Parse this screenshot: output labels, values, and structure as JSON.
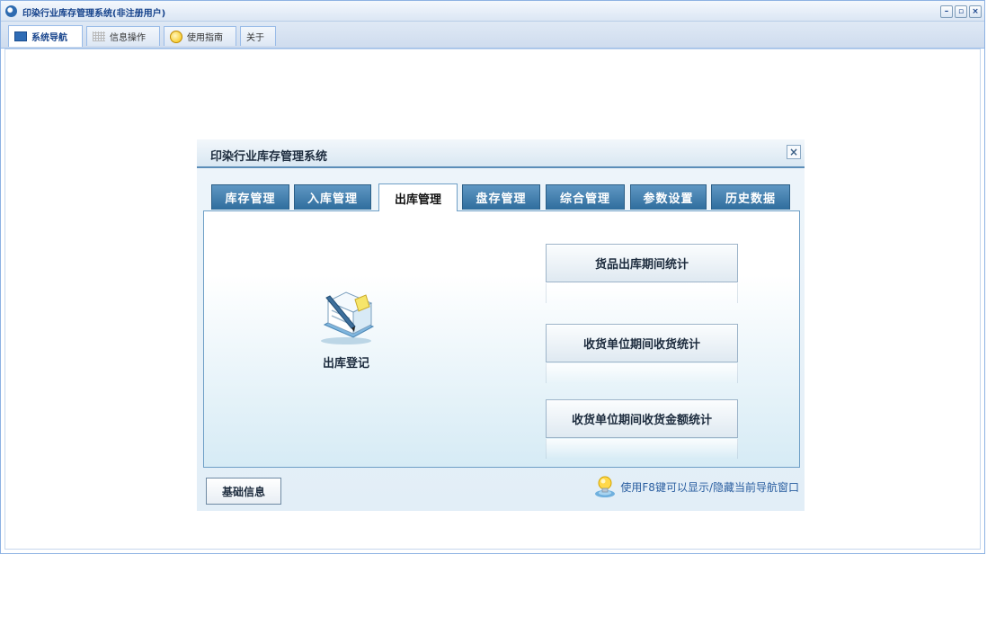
{
  "app": {
    "title": "印染行业库存管理系统(非注册用户)",
    "controls": [
      "–",
      "▫",
      "×"
    ]
  },
  "top_tabs": [
    {
      "label": "系统导航",
      "icon": "monitor-icon",
      "active": true
    },
    {
      "label": "信息操作",
      "icon": "grid-icon",
      "active": false
    },
    {
      "label": "使用指南",
      "icon": "help-icon",
      "active": false
    },
    {
      "label": "关于",
      "icon": "",
      "active": false
    }
  ],
  "dialog": {
    "title": "印染行业库存管理系统",
    "close_label": "×",
    "tabs": [
      "库存管理",
      "入库管理",
      "出库管理",
      "盘存管理",
      "综合管理",
      "参数设置",
      "历史数据"
    ],
    "active_tab": "出库管理",
    "register_label": "出库登记",
    "register_icon": "document-pen-icon",
    "stat_buttons": [
      "货品出库期间统计",
      "收货单位期间收货统计",
      "收货单位期间收货金额统计"
    ],
    "basic_info_label": "基础信息",
    "hint_icon": "lightbulb-icon",
    "hint_text": "使用F8键可以显示/隐藏当前导航窗口"
  },
  "colors": {
    "accent": "#15428b",
    "tab_blue": "#3f7fb0",
    "panel_gradient_end": "#d6ebf5"
  }
}
